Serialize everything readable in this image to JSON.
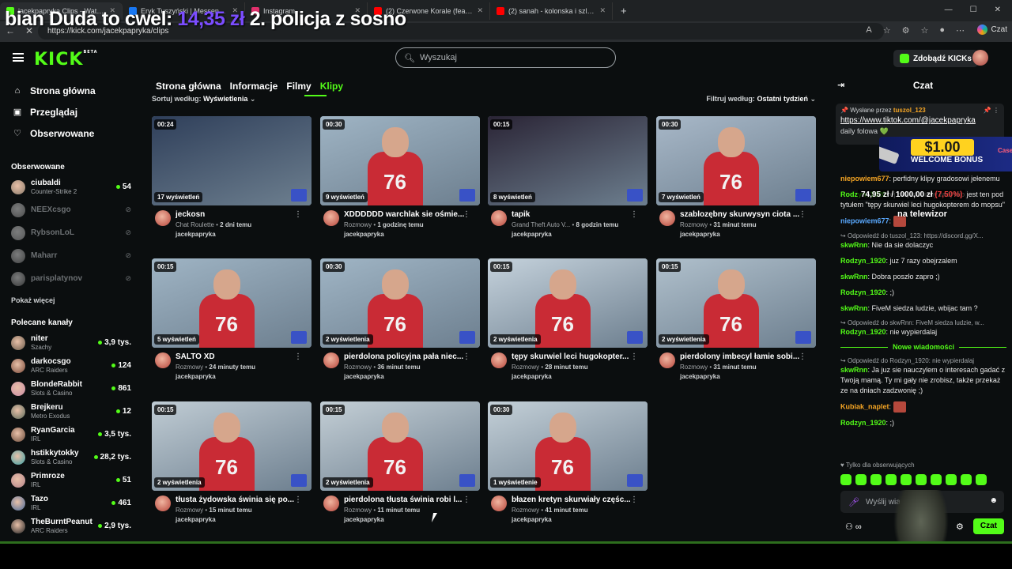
{
  "browser": {
    "tabs": [
      {
        "title": "jacekpapryka Clips - Watch Li",
        "color": "#53fc18",
        "active": true
      },
      {
        "title": "Eryk Tuszyński | Messenger",
        "color": "#1877f2",
        "active": false
      },
      {
        "title": "Instagram",
        "color": "#e1306c",
        "active": false
      },
      {
        "title": "(2) Czerwone Korale (feat. P4T0x)",
        "color": "#ff0000",
        "active": false
      },
      {
        "title": "(2) sanah - kolonska i szlugi (jerk/t",
        "color": "#ff0000",
        "active": false
      }
    ],
    "url": "https://kick.com/jacekpapryka/clips",
    "copilot_label": "Czat"
  },
  "overlay": {
    "left": "bian Duda to cwel: ",
    "price": "14,35 zł",
    "right": " 2. policja z sosno"
  },
  "header": {
    "search_placeholder": "Wyszukaj",
    "kicks_label": "Zdobądź KICKs"
  },
  "sidebar": {
    "nav": [
      {
        "label": "Strona główna",
        "icon": "⌂"
      },
      {
        "label": "Przeglądaj",
        "icon": "▣"
      },
      {
        "label": "Obserwowane",
        "icon": "♡"
      }
    ],
    "followed_title": "Obserwowane",
    "followed": [
      {
        "name": "ciubaldi",
        "cat": "Counter-Strike 2",
        "viewers": "54",
        "online": true,
        "color": "#8b7b6b"
      },
      {
        "name": "NEEXcsgo",
        "cat": "",
        "viewers": "",
        "online": false,
        "color": "#777"
      },
      {
        "name": "RybsonLoL",
        "cat": "",
        "viewers": "",
        "online": false,
        "color": "#888"
      },
      {
        "name": "Maharr",
        "cat": "",
        "viewers": "",
        "online": false,
        "color": "#666"
      },
      {
        "name": "parisplatynov",
        "cat": "",
        "viewers": "",
        "online": false,
        "color": "#555"
      }
    ],
    "show_more": "Pokaż więcej",
    "recommended_title": "Polecane kanały",
    "recommended": [
      {
        "name": "niter",
        "cat": "Szachy",
        "viewers": "3,9 tys.",
        "color": "#6b5b4b"
      },
      {
        "name": "darkocsgo",
        "cat": "ARC Raiders",
        "viewers": "124",
        "color": "#7a4a3a"
      },
      {
        "name": "BlondeRabbit",
        "cat": "Slots & Casino",
        "viewers": "861",
        "color": "#c98aa5"
      },
      {
        "name": "Brejkeru",
        "cat": "Metro Exodus",
        "viewers": "12",
        "color": "#5a6a5a"
      },
      {
        "name": "RyanGarcia",
        "cat": "IRL",
        "viewers": "3,5 tys.",
        "color": "#6b4b3b"
      },
      {
        "name": "hstikkytokky",
        "cat": "Slots & Casino",
        "viewers": "28,2 tys.",
        "color": "#3aa0a5"
      },
      {
        "name": "Primroze",
        "cat": "IRL",
        "viewers": "51",
        "color": "#b5838b"
      },
      {
        "name": "Tazo",
        "cat": "IRL",
        "viewers": "461",
        "color": "#4a6a9a"
      },
      {
        "name": "TheBurntPeanut",
        "cat": "ARC Raiders",
        "viewers": "2,9 tys.",
        "color": "#222"
      }
    ]
  },
  "content": {
    "tabs": [
      "Strona główna",
      "Informacje",
      "Filmy",
      "Klipy"
    ],
    "sort_label": "Sortuj według:",
    "sort_value": "Wyświetlenia",
    "filter_label": "Filtruj według:",
    "filter_value": "Ostatni tydzień",
    "clips": [
      {
        "dur": "00:24",
        "views": "17 wyświetleń",
        "title": "jeckosn",
        "cat": "Chat Roulette",
        "time": "2 dni temu",
        "by": "jacekpapryka",
        "bg": "#2f3f5a"
      },
      {
        "dur": "00:30",
        "views": "9 wyświetleń",
        "title": "XDDDDDD warchlak sie ośmie...",
        "cat": "Rozmowy",
        "time": "1 godzinę temu",
        "by": "jacekpapryka",
        "bg": "#9fb4c4"
      },
      {
        "dur": "00:15",
        "views": "8 wyświetleń",
        "title": "tapik",
        "cat": "Grand Theft Auto V...",
        "time": "8 godzin temu",
        "by": "jacekpapryka",
        "bg": "#2a2435"
      },
      {
        "dur": "00:30",
        "views": "7 wyświetleń",
        "title": "szablozębny skurwysyn ciota ...",
        "cat": "Rozmowy",
        "time": "31 minut temu",
        "by": "jacekpapryka",
        "bg": "#a8b8c8"
      },
      {
        "dur": "00:15",
        "views": "5 wyświetleń",
        "title": "SALTO XD",
        "cat": "Rozmowy",
        "time": "24 minuty temu",
        "by": "jacekpapryka",
        "bg": "#9fb4c4"
      },
      {
        "dur": "00:30",
        "views": "2 wyświetlenia",
        "title": "pierdolona policyjna pała niec...",
        "cat": "Rozmowy",
        "time": "36 minut temu",
        "by": "jacekpapryka",
        "bg": "#a0b5c5"
      },
      {
        "dur": "00:15",
        "views": "2 wyświetlenia",
        "title": "tępy skurwiel leci hugokopter...",
        "cat": "Rozmowy",
        "time": "28 minut temu",
        "by": "jacekpapryka",
        "bg": "#c5d2dc"
      },
      {
        "dur": "00:15",
        "views": "2 wyświetlenia",
        "title": "pierdolony imbecyl łamie sobi...",
        "cat": "Rozmowy",
        "time": "31 minut temu",
        "by": "jacekpapryka",
        "bg": "#b0c0cc"
      },
      {
        "dur": "00:15",
        "views": "2 wyświetlenia",
        "title": "tłusta żydowska świnia się po...",
        "cat": "Rozmowy",
        "time": "15 minut temu",
        "by": "jacekpapryka",
        "bg": "#c0ccd4"
      },
      {
        "dur": "00:15",
        "views": "2 wyświetlenia",
        "title": "pierdolona tłusta świnia robi l...",
        "cat": "Rozmowy",
        "time": "11 minut temu",
        "by": "jacekpapryka",
        "bg": "#c4cfd6"
      },
      {
        "dur": "00:30",
        "views": "1 wyświetlenie",
        "title": "błazen kretyn skurwiały częśc...",
        "cat": "Rozmowy",
        "time": "41 minut temu",
        "by": "jacekpapryka",
        "bg": "#c4d0d8"
      }
    ]
  },
  "chat": {
    "title": "Czat",
    "pinned_prefix": "Wysłane przez",
    "pinned_user": "tuszol_123",
    "pinned_link": "https://www.tiktok.com/@jacekpapryka",
    "pinned_tail": "daily folowa 💚",
    "bonus_amount": "$1.00",
    "bonus_text": "WELCOME BONUS",
    "bonus_brand": "CaseRug",
    "goal": "74,95 zł / 1000,00 zł",
    "goal_pct": "(7,50%)",
    "goal_caption": "na telewizor",
    "messages": [
      {
        "reply": "",
        "user": "niepowiem677",
        "ucolor": "#f5a524",
        "text": "perfidny klipy gradosowi jełenemu"
      },
      {
        "reply": "",
        "user": "Rodzyn_1920",
        "ucolor": "#53fc18",
        "text": "ej mój ulubiony twój klip jest ten pod tytułem \"tępy skurwiel leci hugokopterem do mopsu\""
      },
      {
        "reply": "",
        "user": "niepowiem677",
        "ucolor": "#5aa9ff",
        "text": ""
      },
      {
        "reply": "Odpowiedź do tuszol_123: https://discord.gg/X...",
        "user": "skwRnn",
        "ucolor": "#53fc18",
        "text": "Nie da sie dolaczyc"
      },
      {
        "reply": "",
        "user": "Rodzyn_1920",
        "ucolor": "#53fc18",
        "text": "juz 7 razy obejrzalem"
      },
      {
        "reply": "",
        "user": "skwRnn",
        "ucolor": "#53fc18",
        "text": "Dobra poszło zapro ;)"
      },
      {
        "reply": "",
        "user": "Rodzyn_1920",
        "ucolor": "#53fc18",
        "text": ";)"
      },
      {
        "reply": "",
        "user": "skwRnn",
        "ucolor": "#53fc18",
        "text": "FiveM siedza ludzie, wbijac tam ?"
      },
      {
        "reply": "Odpowiedź do skwRnn: FiveM siedza ludzie, w...",
        "user": "Rodzyn_1920",
        "ucolor": "#53fc18",
        "text": "nie wypierdalaj"
      }
    ],
    "new_messages": "Nowe wiadomości",
    "messages2": [
      {
        "reply": "Odpowiedź do Rodzyn_1920: nie wypierdalaj",
        "user": "skwRnn",
        "ucolor": "#53fc18",
        "text": "Ja juz sie nauczylem o interesach gadać z Twoją mamą. Ty mi gały nie zrobisz, także przekaż ze na dniach zadzwonię ;)"
      },
      {
        "reply": "",
        "user": "Kubiak_naplet",
        "ucolor": "#f5a524",
        "text": ""
      },
      {
        "reply": "",
        "user": "Rodzyn_1920",
        "ucolor": "#53fc18",
        "text": ";)"
      }
    ],
    "followers_only": "Tylko dla obserwujących",
    "input_placeholder": "Wyślij wiadomość",
    "send_label": "Czat"
  }
}
